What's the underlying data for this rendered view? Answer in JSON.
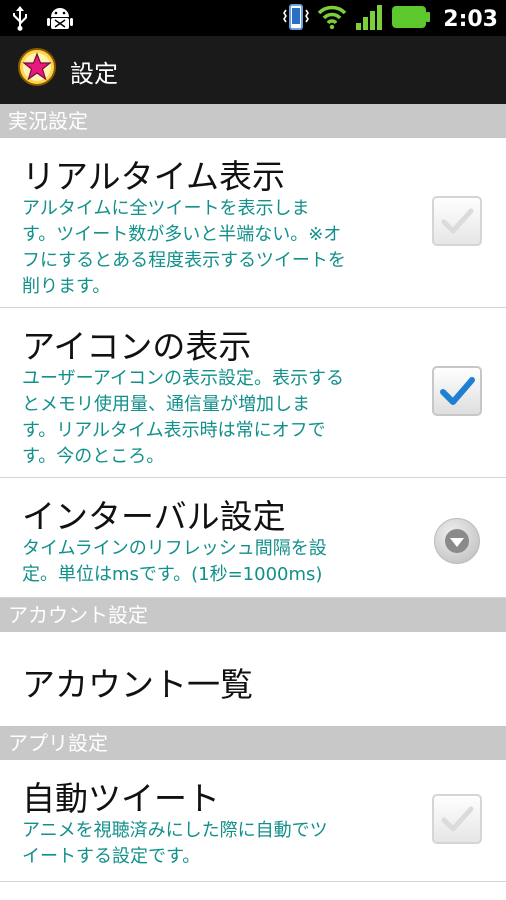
{
  "status_bar": {
    "icons": [
      "usb-icon",
      "android-debug-icon",
      "vibrate-icon",
      "wifi-icon",
      "signal-icon",
      "battery-icon"
    ],
    "time": "2:03"
  },
  "title_bar": {
    "title": "設定",
    "icon": "star-icon"
  },
  "sections": [
    {
      "header": "実況設定",
      "items": [
        {
          "title": "リアルタイム表示",
          "summary_lines": [
            "アルタイムに全ツイートを表示しま",
            "す。ツイート数が多いと半端ない。※オ",
            "フにするとある程度表示するツイートを",
            "削ります。"
          ],
          "control": "checkbox",
          "checked": false
        },
        {
          "title": "アイコンの表示",
          "summary_lines": [
            "ユーザーアイコンの表示設定。表示する",
            "とメモリ使用量、通信量が増加しま",
            "す。リアルタイム表示時は常にオフで",
            "す。今のところ。"
          ],
          "control": "checkbox",
          "checked": true
        },
        {
          "title": "インターバル設定",
          "summary_lines": [
            "タイムラインのリフレッシュ間隔を設",
            "定。単位はmsです。(1秒=1000ms)"
          ],
          "control": "dropdown"
        }
      ]
    },
    {
      "header": "アカウント設定",
      "items": [
        {
          "title": "アカウント一覧"
        }
      ]
    },
    {
      "header": "アプリ設定",
      "items": [
        {
          "title": "自動ツイート",
          "summary_lines": [
            "アニメを視聴済みにした際に自動でツ",
            "イートする設定です。"
          ],
          "control": "checkbox",
          "checked": false
        }
      ]
    }
  ],
  "colors": {
    "summary": "#12908a",
    "section_header_bg": "#c8c8c8",
    "check_blue": "#1f7fd3"
  }
}
